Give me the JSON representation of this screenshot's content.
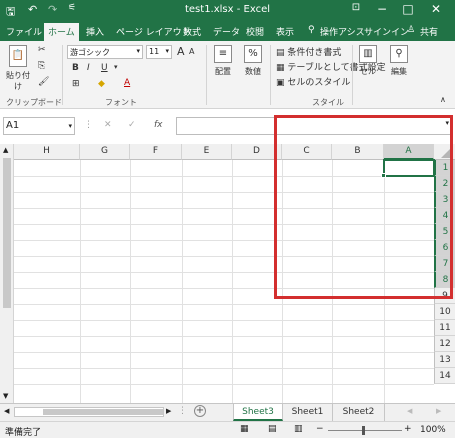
{
  "title": "test1.xlsx - Excel",
  "window_controls": {
    "minimize": "−",
    "maximize": "□",
    "close": "✕",
    "ribbon_options": "⊡"
  },
  "tabs": [
    "ファイル",
    "ホーム",
    "挿入",
    "ページ レイアウト",
    "数式",
    "データ",
    "校閲",
    "表示"
  ],
  "tell_me": "操作アシス",
  "signin": "サインイン",
  "share": "共有",
  "ribbon": {
    "paste": "貼り付け",
    "clipboard": "クリップボード",
    "font_name": "游ゴシック",
    "font_size": "11",
    "font_group": "フォント",
    "bold": "B",
    "italic": "I",
    "underline": "U",
    "align": "配置",
    "number": "数値",
    "conditional": "条件付き書式",
    "table": "テーブルとして書式設定",
    "cellstyle": "セルのスタイル",
    "styles_group": "スタイル",
    "cells": "セル",
    "edit": "編集",
    "grow": "A",
    "shrink": "A",
    "percent": "%",
    "font_color_letter": "A"
  },
  "formula_bar": {
    "name_box": "A1",
    "cancel": "✕",
    "enter": "✓",
    "fx": "fx",
    "value": ""
  },
  "columns": [
    "H",
    "G",
    "F",
    "E",
    "D",
    "C",
    "B",
    "A"
  ],
  "selected_column": "A",
  "rows": [
    "1",
    "2",
    "3",
    "4",
    "5",
    "6",
    "7",
    "8",
    "9",
    "10",
    "11",
    "12",
    "13",
    "14"
  ],
  "selected_rows": [
    "1",
    "2",
    "3",
    "4",
    "5",
    "6",
    "7",
    "8"
  ],
  "sheets": [
    "Sheet3",
    "Sheet1",
    "Sheet2"
  ],
  "active_sheet": "Sheet3",
  "add_sheet": "+",
  "status": "準備完了",
  "zoom": "100%",
  "colors": {
    "excel_green": "#217346",
    "highlight": "#d32f2f"
  }
}
